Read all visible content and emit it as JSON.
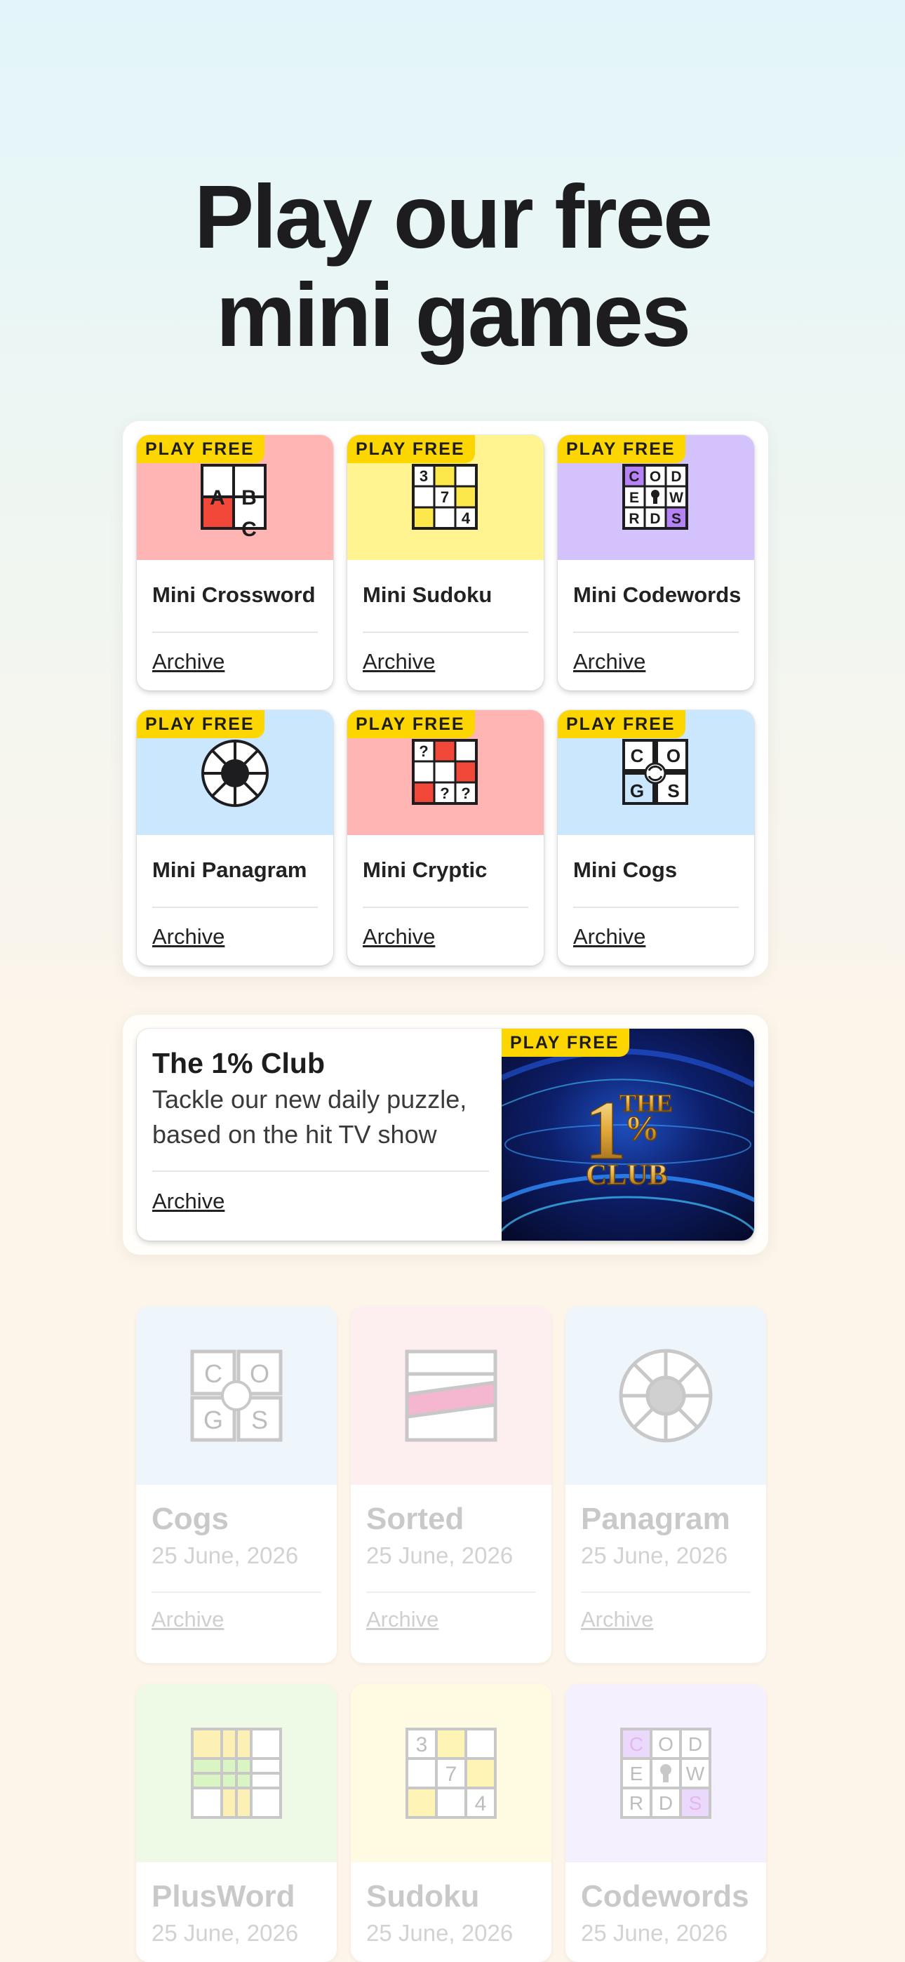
{
  "hero": {
    "title_line1": "Play our free",
    "title_line2": "mini games"
  },
  "badge_label": "PLAY FREE",
  "archive_label": "Archive",
  "mini_games": [
    {
      "name": "Mini Crossword",
      "icon": "mini-crossword-icon",
      "bg": "#ffb5b3"
    },
    {
      "name": "Mini Sudoku",
      "icon": "mini-sudoku-icon",
      "bg": "#fff48f"
    },
    {
      "name": "Mini Codewords",
      "icon": "mini-codewords-icon",
      "bg": "#d3c2fb"
    },
    {
      "name": "Mini Panagram",
      "icon": "mini-panagram-icon",
      "bg": "#cbe7fd"
    },
    {
      "name": "Mini Cryptic",
      "icon": "mini-cryptic-icon",
      "bg": "#ffb5b3"
    },
    {
      "name": "Mini Cogs",
      "icon": "mini-cogs-icon",
      "bg": "#cbe7fd"
    }
  ],
  "icon_letters": {
    "crossword": [
      "A",
      "B",
      "C"
    ],
    "sudoku": [
      "3",
      "7",
      "4"
    ],
    "codewords": [
      "C",
      "O",
      "D",
      "E",
      "W",
      "R",
      "D",
      "S"
    ],
    "cryptic": [
      "?",
      "?",
      "?"
    ],
    "cogs": [
      "C",
      "O",
      "G",
      "S"
    ]
  },
  "club": {
    "title": "The 1% Club",
    "description": "Tackle our new daily puzzle, based on the hit TV show",
    "logo_icon": "one-percent-club-logo"
  },
  "games": [
    {
      "name": "Cogs",
      "date": "25 June, 2026",
      "icon": "cogs-icon",
      "bg": "#eef5fb"
    },
    {
      "name": "Sorted",
      "date": "25 June, 2026",
      "icon": "sorted-icon",
      "bg": "#fdeef0"
    },
    {
      "name": "Panagram",
      "date": "25 June, 2026",
      "icon": "panagram-icon",
      "bg": "#eef5fb"
    },
    {
      "name": "PlusWord",
      "date": "25 June, 2026",
      "icon": "plusword-icon",
      "bg": "#eefae6"
    },
    {
      "name": "Sudoku",
      "date": "25 June, 2026",
      "icon": "sudoku-icon",
      "bg": "#fefbe2"
    },
    {
      "name": "Codewords",
      "date": "25 June, 2026",
      "icon": "codewords-icon",
      "bg": "#f4f0fe"
    }
  ],
  "colors": {
    "badge": "#fdd600",
    "crossword_red": "#f2483a",
    "sudoku_yellow": "#fde84c",
    "codewords_purple": "#b583f6",
    "club_navy": "#0b1447"
  }
}
